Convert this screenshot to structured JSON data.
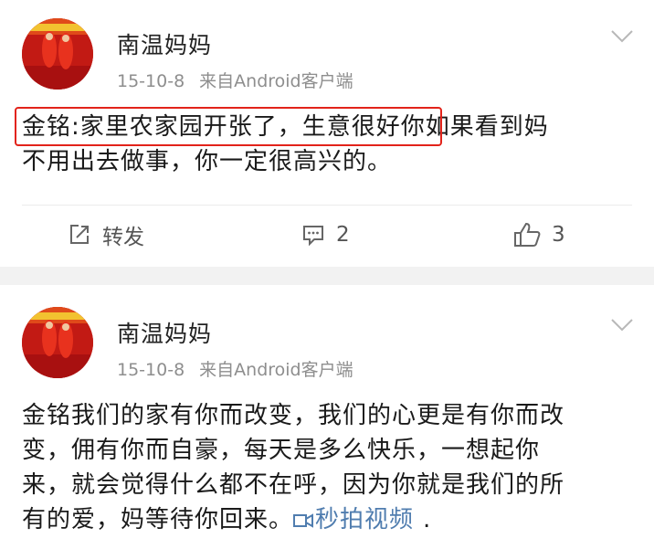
{
  "colors": {
    "link": "#507daf",
    "highlight": "#e2231a",
    "meta": "#8e8e8e",
    "separator": "#f2f2f2"
  },
  "posts": [
    {
      "author": "南温妈妈",
      "date": "15-10-8",
      "source": "来自Android客户端",
      "text_first_line_highlight": "金铭:家里农家园开张了，生意很好",
      "text_first_line_rest": "你如果看到妈",
      "text_second_line": "不用出去做事，你一定很高兴的。",
      "actions": {
        "repost_label": "转发",
        "comment_count": "2",
        "like_count": "3"
      }
    },
    {
      "author": "南温妈妈",
      "date": "15-10-8",
      "source": "来自Android客户端",
      "text_lines": [
        "金铭我们的家有你而改变，我们的心更是有你而改",
        "变，佣有你而自豪，每天是多么快乐，一想起你",
        "来，就会觉得什么都不在呼，因为你就是我们的所"
      ],
      "text_last_line": "有的爱，妈等待你回来。",
      "video_link": "秒拍视频",
      "trailing": "."
    }
  ]
}
